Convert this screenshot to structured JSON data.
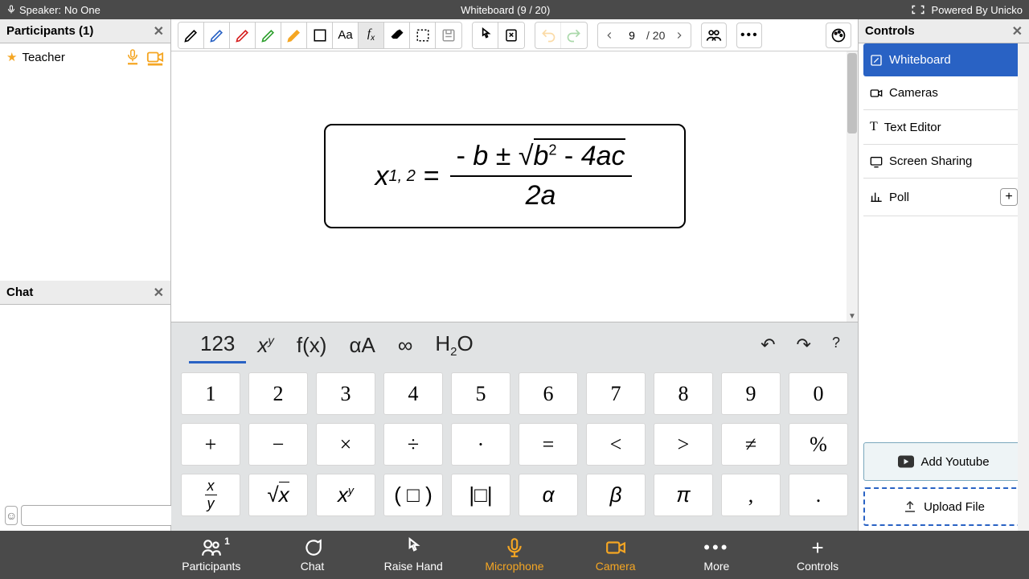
{
  "topbar": {
    "speaker_label": "Speaker:",
    "speaker_name": "No One",
    "title": "Whiteboard (9 / 20)",
    "powered": "Powered By Unicko"
  },
  "participants": {
    "header": "Participants (1)",
    "items": [
      {
        "name": "Teacher"
      }
    ]
  },
  "chat": {
    "header": "Chat"
  },
  "toolbar": {
    "page_current": "9",
    "page_total": "/ 20"
  },
  "chart_data": {
    "type": "table",
    "title": "Quadratic formula displayed on whiteboard",
    "formula_latex": "x_{1,2} = \\frac{-b \\pm \\sqrt{b^2 - 4ac}}{2a}"
  },
  "math_keyboard": {
    "tabs": [
      "123",
      "x^y",
      "f(x)",
      "αA",
      "∞"
    ],
    "tab_h2o": "H2O",
    "rows": [
      [
        "1",
        "2",
        "3",
        "4",
        "5",
        "6",
        "7",
        "8",
        "9",
        "0"
      ],
      [
        "+",
        "−",
        "×",
        "÷",
        "·",
        "=",
        "<",
        ">",
        "≠",
        "%"
      ],
      [
        "x/y",
        "√x",
        "x^y",
        "( □ )",
        "|□|",
        "α",
        "β",
        "π",
        ",",
        "."
      ]
    ]
  },
  "controls": {
    "header": "Controls",
    "items": [
      {
        "icon": "edit",
        "label": "Whiteboard",
        "active": true
      },
      {
        "icon": "camera",
        "label": "Cameras"
      },
      {
        "icon": "text",
        "label": "Text Editor"
      },
      {
        "icon": "screen",
        "label": "Screen Sharing"
      },
      {
        "icon": "poll",
        "label": "Poll",
        "plus": true
      }
    ],
    "youtube": "Add Youtube",
    "upload": "Upload File"
  },
  "bottombar": {
    "items": [
      {
        "key": "participants",
        "label": "Participants",
        "badge": "1"
      },
      {
        "key": "chat",
        "label": "Chat"
      },
      {
        "key": "raise",
        "label": "Raise Hand"
      },
      {
        "key": "mic",
        "label": "Microphone",
        "orange": true
      },
      {
        "key": "camera",
        "label": "Camera",
        "orange": true
      },
      {
        "key": "more",
        "label": "More"
      },
      {
        "key": "controls",
        "label": "Controls"
      }
    ]
  }
}
